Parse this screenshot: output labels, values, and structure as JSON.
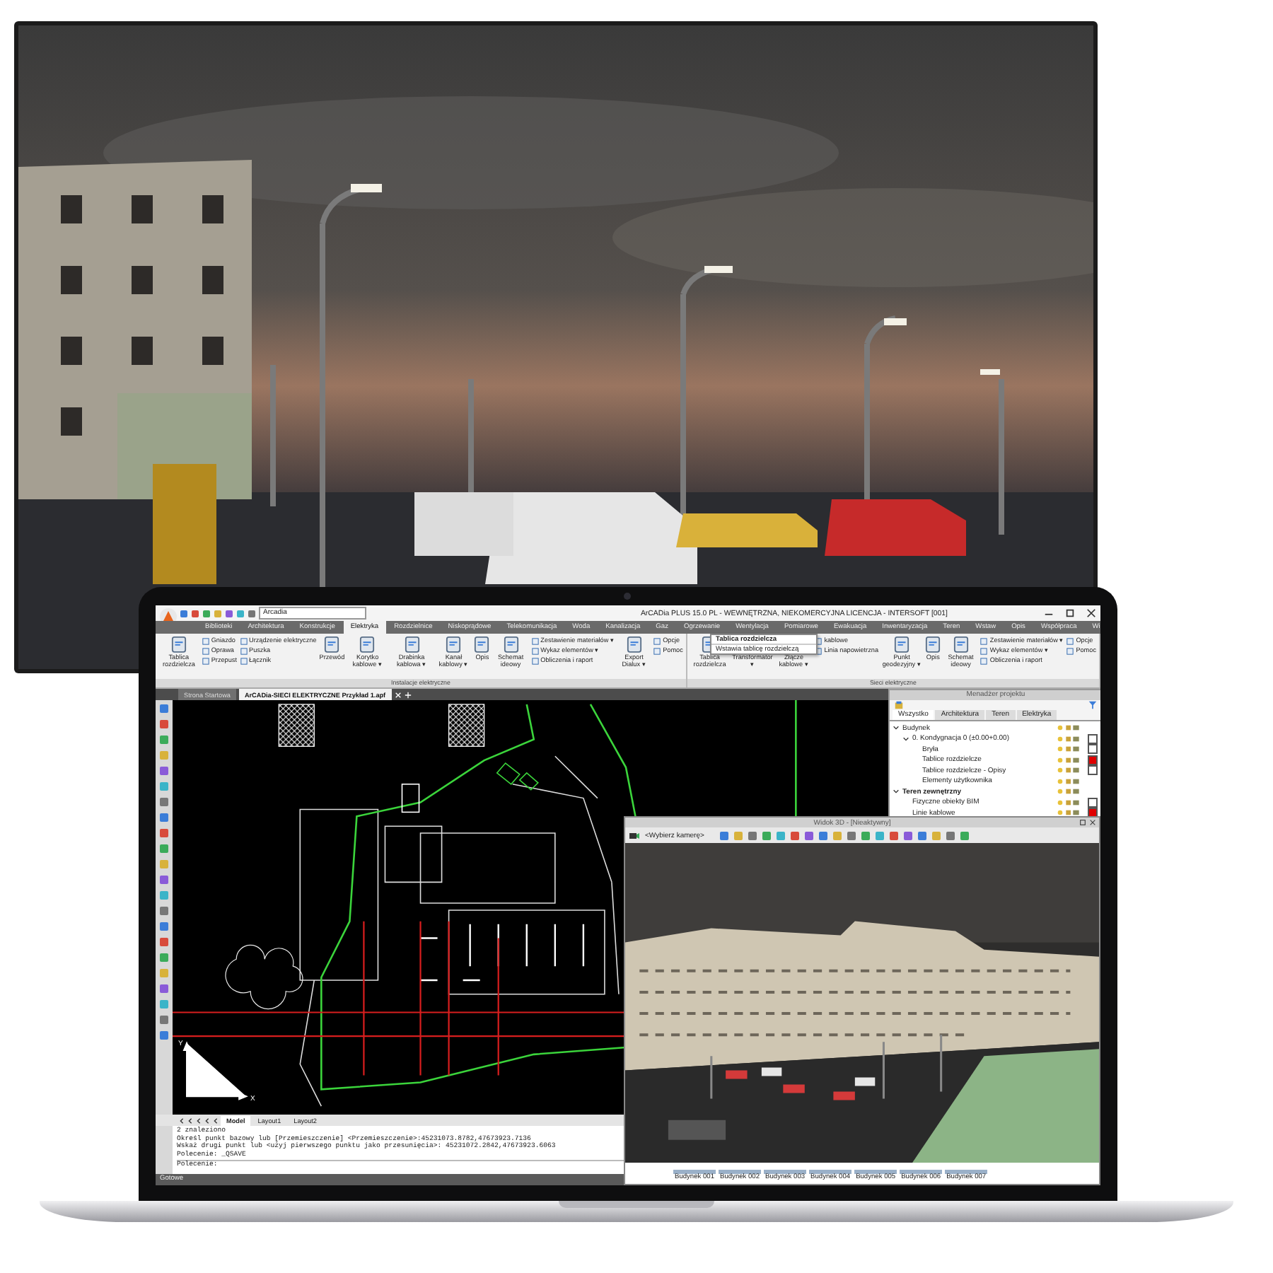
{
  "app": {
    "title": "ArCADia PLUS 15.0 PL - WEWNĘTRZNA, NIEKOMERCYJNA LICENCJA - INTERSOFT [001]",
    "profile_combo": "Arcadia",
    "menu_tabs": [
      {
        "label": "Biblioteki",
        "selected": false
      },
      {
        "label": "Architektura",
        "selected": false
      },
      {
        "label": "Konstrukcje",
        "selected": false
      },
      {
        "label": "Elektryka",
        "selected": true
      },
      {
        "label": "Rozdzielnice",
        "selected": false
      },
      {
        "label": "Niskoprądowe",
        "selected": false
      },
      {
        "label": "Telekomunikacja",
        "selected": false
      },
      {
        "label": "Woda",
        "selected": false
      },
      {
        "label": "Kanalizacja",
        "selected": false
      },
      {
        "label": "Gaz",
        "selected": false
      },
      {
        "label": "Ogrzewanie",
        "selected": false
      },
      {
        "label": "Wentylacja",
        "selected": false
      },
      {
        "label": "Pomiarowe",
        "selected": false
      },
      {
        "label": "Ewakuacja",
        "selected": false
      },
      {
        "label": "Inwentaryzacja",
        "selected": false
      },
      {
        "label": "Teren",
        "selected": false
      },
      {
        "label": "Wstaw",
        "selected": false
      },
      {
        "label": "Opis",
        "selected": false
      },
      {
        "label": "Współpraca",
        "selected": false
      },
      {
        "label": "Wi",
        "selected": false
      }
    ],
    "ribbon": {
      "groups": [
        {
          "title": "Instalacje elektryczne",
          "items": [
            {
              "kind": "large",
              "label": "Tablica rozdzielcza"
            },
            {
              "kind": "stack",
              "items": [
                "Gniazdo",
                "Oprawa",
                "Przepust"
              ]
            },
            {
              "kind": "stack",
              "items": [
                "Urządzenie elektryczne",
                "Puszka",
                "Łącznik"
              ]
            },
            {
              "kind": "large",
              "label": "Przewód"
            },
            {
              "kind": "large",
              "label": "Korytko kablowe ▾"
            },
            {
              "kind": "large",
              "label": "Drabinka kablowa ▾"
            },
            {
              "kind": "large",
              "label": "Kanał kablowy ▾"
            },
            {
              "kind": "large",
              "label": "Opis"
            },
            {
              "kind": "large",
              "label": "Schemat ideowy"
            },
            {
              "kind": "stack",
              "items": [
                "Zestawienie materiałów ▾",
                "Wykaz elementów ▾",
                "Obliczenia i raport"
              ]
            },
            {
              "kind": "large",
              "label": "Export Dialux ▾"
            },
            {
              "kind": "stack",
              "items": [
                "Opcje",
                "Pomoc"
              ]
            }
          ]
        },
        {
          "title": "Sieci elektryczne",
          "items": [
            {
              "kind": "large",
              "label": "Tablica rozdzielcza"
            },
            {
              "kind": "large",
              "label": "Transformator ▾"
            },
            {
              "kind": "large",
              "label": "Złącze kablowe ▾"
            },
            {
              "kind": "stack",
              "items": [
                "kablowe",
                "Linia napowietrzna"
              ]
            },
            {
              "kind": "large",
              "label": "Punkt geodezyjny ▾"
            },
            {
              "kind": "large",
              "label": "Opis"
            },
            {
              "kind": "large",
              "label": "Schemat ideowy"
            },
            {
              "kind": "stack",
              "items": [
                "Zestawienie materiałów ▾",
                "Wykaz elementów ▾",
                "Obliczenia i raport"
              ]
            },
            {
              "kind": "stack",
              "items": [
                "Opcje",
                "Pomoc"
              ]
            }
          ]
        }
      ]
    },
    "dropdown": {
      "header": "Tablica rozdzielcza",
      "description": "Wstawia tablicę rozdzielczą"
    },
    "doc_tabs": [
      {
        "label": "Strona Startowa",
        "selected": false
      },
      {
        "label": "ArCADia-SIECI ELEKTRYCZNE Przykład 1.apf",
        "selected": true
      }
    ],
    "axis_labels": [
      "Y",
      "X"
    ],
    "layout_tabs": [
      {
        "label": "Model",
        "selected": true
      },
      {
        "label": "Layout1",
        "selected": false
      },
      {
        "label": "Layout2",
        "selected": false
      }
    ],
    "command_lines": [
      "2 znaleziono",
      "Określ punkt bazowy lub [Przemieszczenie] <Przemieszczenie>:45231073.8782,47673923.7136",
      "Wskaż drugi punkt lub <użyj pierwszego punktu jako przesunięcia>: 45231072.2842,47673923.6063",
      "Polecenie: _QSAVE"
    ],
    "command_prompt": "Polecenie:",
    "status": "Gotowe",
    "project_manager": {
      "title": "Menadżer projektu",
      "tabs": [
        {
          "label": "Wszystko",
          "selected": true
        },
        {
          "label": "Architektura",
          "selected": false
        },
        {
          "label": "Teren",
          "selected": false
        },
        {
          "label": "Elektryka",
          "selected": false
        }
      ],
      "tree": [
        {
          "label": "Budynek",
          "expanded": true,
          "children": [
            {
              "label": "0. Kondygnacja 0 (±0.00+0.00)",
              "color": "#ffffff",
              "expanded": true,
              "children": [
                {
                  "label": "Bryła",
                  "color": "#ffffff"
                },
                {
                  "label": "Tablice rozdzielcze",
                  "color": "#e00000"
                },
                {
                  "label": "Tablice rozdzielcze - Opisy",
                  "color": "#ffffff"
                },
                {
                  "label": "Elementy użytkownika"
                }
              ]
            }
          ]
        },
        {
          "label": "Teren zewnętrzny",
          "bold": true,
          "expanded": true,
          "children": [
            {
              "label": "Fizyczne obiekty BIM",
              "color": "#ffffff"
            },
            {
              "label": "Linie kablowe",
              "color": "#e00000"
            }
          ]
        }
      ]
    },
    "view3d": {
      "title": "Widok 3D - [Nieaktywny]",
      "camera_combo": "<Wybierz kamerę>",
      "buildings": [
        "Budynek 001",
        "Budynek 002",
        "Budynek 003",
        "Budynek 004",
        "Budynek 005",
        "Budynek 006",
        "Budynek 007"
      ]
    }
  }
}
